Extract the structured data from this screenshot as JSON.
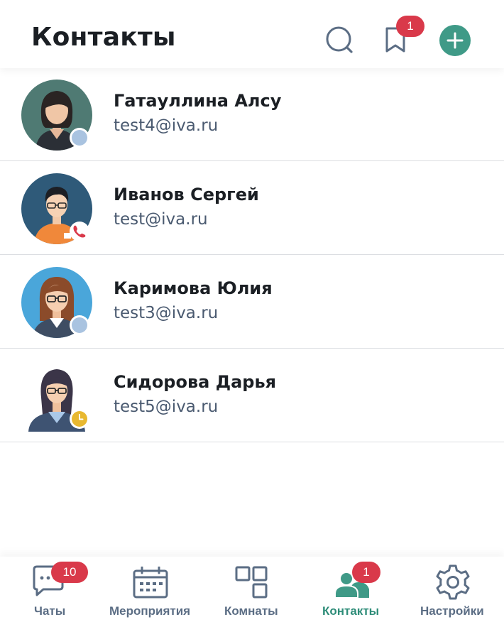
{
  "header": {
    "title": "Контакты",
    "bookmarks_badge": "1",
    "accent_color": "#3f9a87"
  },
  "contacts": [
    {
      "name": "Гатауллина Алсу",
      "email": "test4@iva.ru",
      "status": "offline"
    },
    {
      "name": "Иванов Сергей",
      "email": "test@iva.ru",
      "status": "in-call"
    },
    {
      "name": "Каримова Юлия",
      "email": "test3@iva.ru",
      "status": "offline"
    },
    {
      "name": "Сидорова Дарья",
      "email": "test5@iva.ru",
      "status": "away"
    }
  ],
  "tabs": [
    {
      "label": "Чаты",
      "badge": "10",
      "icon": "chat-icon"
    },
    {
      "label": "Мероприятия",
      "icon": "calendar-icon"
    },
    {
      "label": "Комнаты",
      "icon": "rooms-icon"
    },
    {
      "label": "Контакты",
      "badge": "1",
      "icon": "contacts-icon",
      "active": true
    },
    {
      "label": "Настройки",
      "icon": "gear-icon"
    }
  ],
  "colors": {
    "badge": "#d9394a",
    "status_offline": "#a9c3e0",
    "status_call": "#d9394a",
    "status_away": "#e8b830",
    "active_tab": "#2f8d79",
    "inactive_tab": "#5b6d84"
  }
}
